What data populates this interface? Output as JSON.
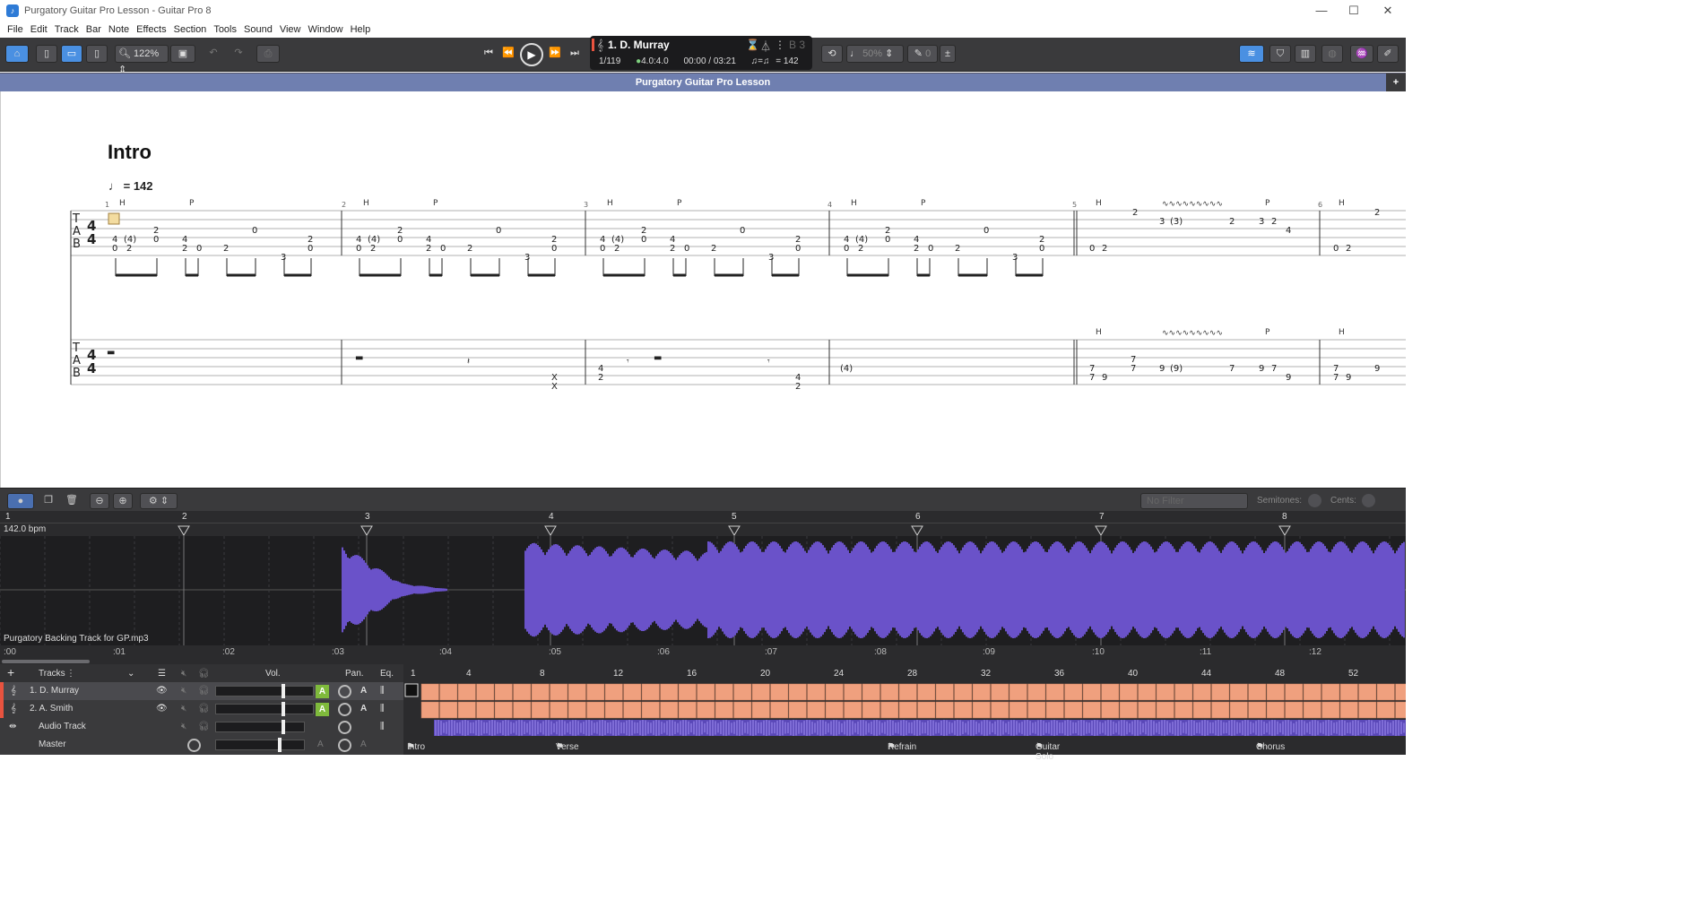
{
  "window": {
    "title": "Purgatory Guitar Pro Lesson - Guitar Pro 8"
  },
  "menu": [
    "File",
    "Edit",
    "Track",
    "Bar",
    "Note",
    "Effects",
    "Section",
    "Tools",
    "Sound",
    "View",
    "Window",
    "Help"
  ],
  "toolbar": {
    "zoom": "122%",
    "tempo_pct": "50%",
    "tuner_val": "0"
  },
  "lcd": {
    "track": "1. D. Murray",
    "bar": "1/119",
    "sig": "4.0:4.0",
    "time": "00:00 / 03:21",
    "tempo": "= 142",
    "key": "B 3"
  },
  "tab": {
    "title": "Purgatory Guitar Pro Lesson",
    "add": "+"
  },
  "score": {
    "section": "Intro",
    "tempo": "= 142",
    "bar_numbers": [
      "1",
      "2",
      "3",
      "4",
      "5",
      "6"
    ],
    "clef": "TAB",
    "timesig": "4/4"
  },
  "audio": {
    "filter": "No Filter",
    "semitones": "Semitones:",
    "cents": "Cents:"
  },
  "ruler": {
    "bars": [
      "1",
      "2",
      "3",
      "4",
      "5",
      "6",
      "7",
      "8"
    ],
    "bpm": "142.0 bpm"
  },
  "wave": {
    "filename": "Purgatory Backing Track for GP.mp3"
  },
  "timeline": [
    ":00",
    ":01",
    ":02",
    ":03",
    ":04",
    ":05",
    ":06",
    ":07",
    ":08",
    ":09",
    ":10",
    ":11",
    ":12"
  ],
  "tracks": {
    "header": {
      "label": "Tracks",
      "vol": "Vol.",
      "pan": "Pan.",
      "eq": "Eq.",
      "add": "+"
    },
    "rows": [
      {
        "name": "1. D. Murray",
        "auto": "A"
      },
      {
        "name": "2. A. Smith",
        "auto": "A"
      },
      {
        "name": "Audio Track"
      },
      {
        "name": "Master"
      }
    ]
  },
  "bar_ruler": [
    "1",
    "4",
    "8",
    "12",
    "16",
    "20",
    "24",
    "28",
    "32",
    "36",
    "40",
    "44",
    "48",
    "52"
  ],
  "markers": [
    "Intro",
    "Verse",
    "Refrain",
    "Guitar Solo",
    "Chorus"
  ],
  "colors": {
    "toolbar": "#3a3a3c",
    "accent": "#4a90e2",
    "wave": "#6a52c9",
    "track_block": "#f0a07e",
    "tab_header": "#6f7fb0"
  }
}
